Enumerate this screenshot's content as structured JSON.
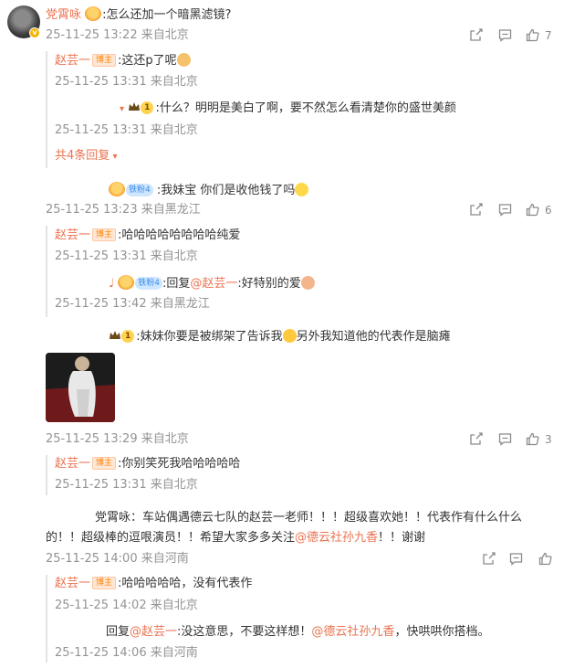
{
  "c1": {
    "name": "党霄咏",
    "text": ":怎么还加一个暗黑滤镜?",
    "meta": "25-11-25 13:22 来自北京",
    "likes": "7",
    "r1": {
      "name": "赵芸一",
      "badge": "博主",
      "text": ":这还p了呢",
      "meta": "25-11-25 13:31 来自北京"
    },
    "r2": {
      "level": "1",
      "text": ":什么？明明是美白了啊，要不然怎么看清楚你的盛世美颜",
      "meta": "25-11-25 13:31 来自北京"
    },
    "more": "共4条回复"
  },
  "c2": {
    "fan": "铁粉4",
    "text": ":我妹宝 你们是收他钱了吗",
    "meta": "25-11-25 13:23 来自黑龙江",
    "likes": "6",
    "r1": {
      "name": "赵芸一",
      "badge": "博主",
      "text": ":哈哈哈哈哈哈哈哈纯爱",
      "meta": "25-11-25 13:31 来自北京"
    },
    "r2": {
      "prefix": "♩",
      "fan": "铁粉4",
      "reply": ":回复",
      "mention": "@赵芸一",
      "text": ":好特别的爱",
      "meta": "25-11-25 13:42 来自黑龙江"
    }
  },
  "c3": {
    "level": "1",
    "text_a": ":妹妹你要是被绑架了告诉我",
    "text_b": "另外我知道他的代表作是脑瘫",
    "meta": "25-11-25 13:29 来自北京",
    "likes": "3",
    "r1": {
      "name": "赵芸一",
      "badge": "博主",
      "text": ":你别笑死我哈哈哈哈哈",
      "meta": "25-11-25 13:31 来自北京"
    }
  },
  "c4": {
    "line1": "党霄咏：车站偶遇德云七队的赵芸一老师！！！超级喜欢她！！代表作有什么什么",
    "line2_a": "的！！超级棒的逗哏演员！！希望大家多多关注",
    "line2_mention": "@德云社孙九香",
    "line2_b": "！！谢谢",
    "meta": "25-11-25 14:00 来自河南",
    "r1": {
      "name": "赵芸一",
      "badge": "博主",
      "text": ":哈哈哈哈哈，没有代表作",
      "meta": "25-11-25 14:02 来自北京"
    },
    "r2": {
      "reply": "回复",
      "mention": "@赵芸一",
      "text": ":没这意思，不要这样想！",
      "mention2": "@德云社孙九香",
      "text2": "，快哄哄你搭档。",
      "meta": "25-11-25 14:06 来自河南"
    }
  }
}
